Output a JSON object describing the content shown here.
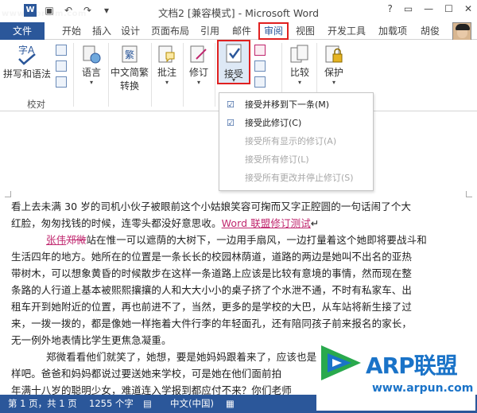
{
  "watermark_top": "www.wordlm.com",
  "title_bar": {
    "title": "文档2 [兼容模式] - Microsoft Word",
    "controls": [
      "?",
      "▭",
      "—",
      "☐",
      "✕"
    ]
  },
  "tabs": {
    "file": "文件",
    "items": [
      "开始",
      "插入",
      "设计",
      "页面布局",
      "引用",
      "邮件",
      "审阅",
      "视图",
      "开发工具",
      "加载项"
    ],
    "active": "审阅",
    "user": "胡俊"
  },
  "ribbon": {
    "spelling": "拼写和语法",
    "language": "语言",
    "chinese_conv_1": "中文简繁",
    "chinese_conv_2": "转换",
    "comment": "批注",
    "track": "修订",
    "accept": "接受",
    "compare": "比较",
    "protect": "保护",
    "group_proofing": "校对"
  },
  "accept_menu": {
    "items": [
      {
        "label": "接受并移到下一条(M)",
        "enabled": true
      },
      {
        "label": "接受此修订(C)",
        "enabled": true
      },
      {
        "label": "接受所有显示的修订(A)",
        "enabled": false
      },
      {
        "label": "接受所有修订(L)",
        "enabled": false
      },
      {
        "label": "接受所有更改并停止修订(S)",
        "enabled": false
      }
    ]
  },
  "document": {
    "line1": "看上去未满 30 岁的司机小伙子被眼前这个小姑娘笑容可掬而又字正腔圆的一句话闹了个大",
    "line2a": "红脸，匆匆找钱的时候，连零头都没好意思收。",
    "line2b": "Word 联盟修订测试",
    "line3a": "张伟",
    "line3b": "郑微",
    "line3c": "站在惟一可以遮荫的大树下，一边用手扇风，一边打量着这个她即将要战斗和",
    "line4": "生活四年的地方。她所在的位置是一条长长的校园林荫道，道路的两边是她叫不出名的亚热",
    "line5": "带树木，可以想象黄昏的时候散步在这样一条道路上应该是比较有意境的事情，然而现在整",
    "line6": "条路的人行道上基本被熙熙攘攘的人和大大小小的桌子挤了个水泄不通，不时有私家车、出",
    "line7": "租车开到她附近的位置，再也前进不了，当然，更多的是学校的大巴，从车站将新生接了过",
    "line8": "来，一拨一拨的，都是像她一样拖着大件行李的年轻面孔，还有陪同孩子前来报名的家长，",
    "line9": "无一例外地表情比学生更焦急凝重。",
    "line10": "郑微看看他们就笑了，她想，要是她妈妈跟着来了，应该也是这付自产不急九监急的模",
    "line11": "样吧。爸爸和妈妈都说过要送她来学校，可是她在他们面前拍",
    "line12": "年满十八岁的聪明少女，难道连入学报到都应付不来？你们老师"
  },
  "status": {
    "page": "第 1 页，共 1 页",
    "words": "1255 个字",
    "lang": "中文(中国)"
  },
  "watermark": {
    "brand": "ARP联盟",
    "url": "www.arpun.com"
  }
}
